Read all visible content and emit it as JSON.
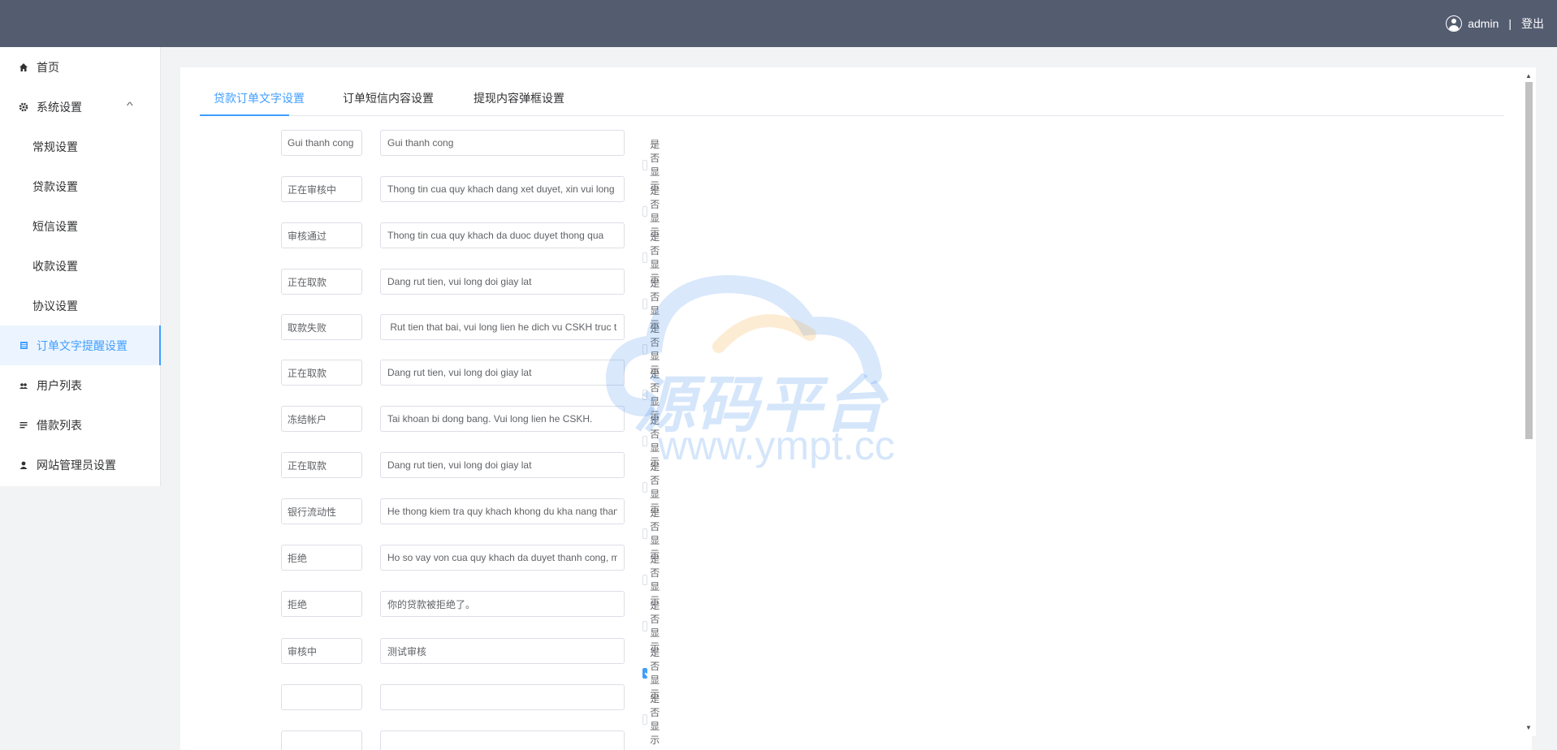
{
  "header": {
    "username": "admin",
    "separator": "|",
    "logout_label": "登出"
  },
  "sidebar": {
    "items": [
      {
        "label": "首页",
        "icon": "home-icon"
      },
      {
        "label": "系统设置",
        "icon": "gear-icon"
      },
      {
        "label": "常规设置"
      },
      {
        "label": "贷款设置"
      },
      {
        "label": "短信设置"
      },
      {
        "label": "收款设置"
      },
      {
        "label": "协议设置"
      },
      {
        "label": "订单文字提醒设置",
        "icon": "document-icon"
      },
      {
        "label": "用户列表",
        "icon": "users-icon"
      },
      {
        "label": "借款列表",
        "icon": "list-icon"
      },
      {
        "label": "网站管理员设置",
        "icon": "user-icon"
      }
    ]
  },
  "tabs": [
    {
      "label": "贷款订单文字设置"
    },
    {
      "label": "订单短信内容设置"
    },
    {
      "label": "提现内容弹框设置"
    }
  ],
  "checkbox_label": "是否显示",
  "rows": [
    {
      "key": "Gui thanh cong",
      "value": "Gui thanh cong",
      "checked": false
    },
    {
      "key": "正在审核中",
      "value": "Thong tin cua quy khach dang xet duyet, xin vui long",
      "checked": false
    },
    {
      "key": "审核通过",
      "value": "Thong tin cua quy khach da duoc duyet thong qua",
      "checked": false
    },
    {
      "key": "正在取款",
      "value": "Dang rut tien, vui long doi giay lat",
      "checked": false
    },
    {
      "key": "取款失败",
      "value": " Rut tien that bai, vui long lien he dich vu CSKH truc t",
      "checked": false
    },
    {
      "key": "正在取款",
      "value": "Dang rut tien, vui long doi giay lat",
      "checked": false
    },
    {
      "key": "冻结帐户",
      "value": "Tai khoan bi dong bang. Vui long lien he CSKH.",
      "checked": false
    },
    {
      "key": "正在取款",
      "value": "Dang rut tien, vui long doi giay lat",
      "checked": false
    },
    {
      "key": "银行流动性",
      "value": "He thong kiem tra quy khach khong du kha nang than",
      "checked": false
    },
    {
      "key": "拒绝",
      "value": "Ho so vay von cua quy khach da duyet thanh cong, m",
      "checked": false
    },
    {
      "key": "拒绝",
      "value": "你的贷款被拒绝了。",
      "checked": false
    },
    {
      "key": "审核中",
      "value": "测试审核",
      "checked": true
    },
    {
      "key": "",
      "value": "",
      "checked": false
    }
  ],
  "watermark": {
    "title": "源码平台",
    "url": "www.ympt.cc"
  },
  "colors": {
    "header_bg": "#545c70",
    "accent": "#409eff",
    "active_bg": "#ecf5ff"
  }
}
